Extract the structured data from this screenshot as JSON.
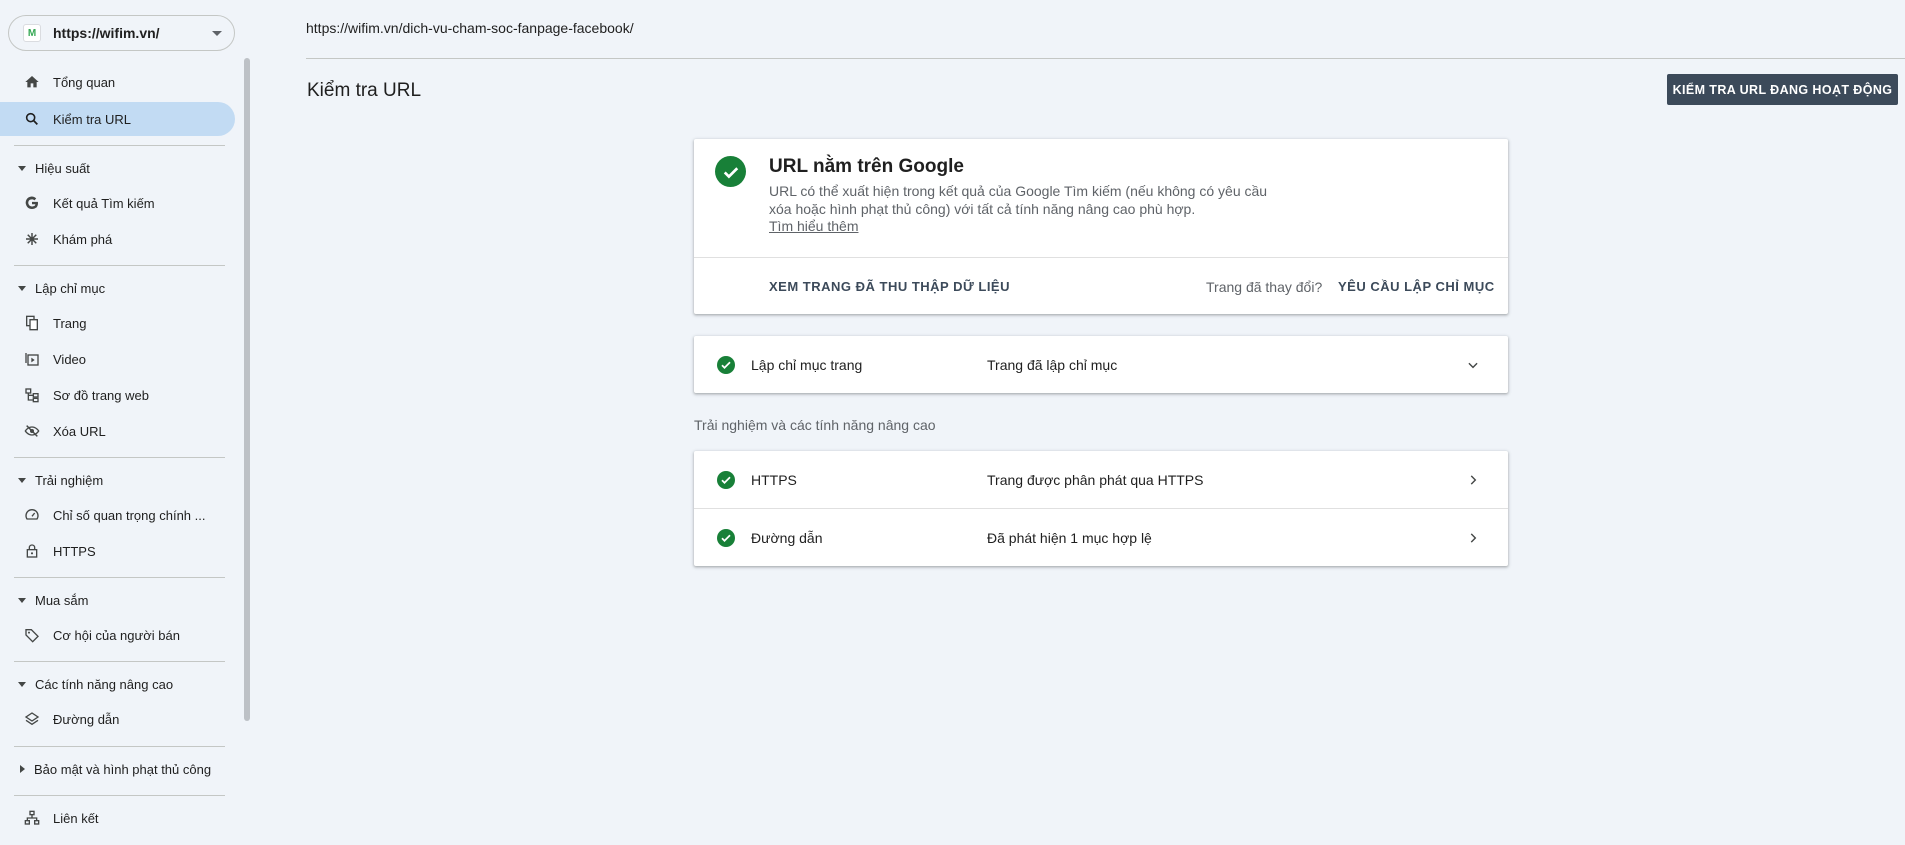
{
  "property": {
    "label": "https://wifim.vn/",
    "favicon_text": "M"
  },
  "sidebar": {
    "items": [
      {
        "label": "Tổng quan",
        "icon": "home-icon"
      },
      {
        "label": "Kiểm tra URL",
        "icon": "search-icon",
        "active": true
      }
    ],
    "sections": [
      {
        "label": "Hiệu suất",
        "items": [
          {
            "label": "Kết quả Tìm kiếm",
            "icon": "google-g-icon"
          },
          {
            "label": "Khám phá",
            "icon": "discover-asterisk-icon"
          }
        ]
      },
      {
        "label": "Lập chỉ mục",
        "items": [
          {
            "label": "Trang",
            "icon": "pages-icon"
          },
          {
            "label": "Video",
            "icon": "video-icon"
          },
          {
            "label": "Sơ đồ trang web",
            "icon": "sitemap-icon"
          },
          {
            "label": "Xóa URL",
            "icon": "eye-off-icon"
          }
        ]
      },
      {
        "label": "Trải nghiệm",
        "items": [
          {
            "label": "Chỉ số quan trọng chính ...",
            "icon": "speedometer-icon"
          },
          {
            "label": "HTTPS",
            "icon": "lock-icon"
          }
        ]
      },
      {
        "label": "Mua sắm",
        "items": [
          {
            "label": "Cơ hội của người bán",
            "icon": "tag-icon"
          }
        ]
      },
      {
        "label": "Các tính năng nâng cao",
        "items": [
          {
            "label": "Đường dẫn",
            "icon": "layers-icon"
          }
        ]
      },
      {
        "label": "Bảo mật và hình phạt thủ công",
        "collapsed": true
      },
      {
        "label": "Liên kết",
        "icon": "links-icon"
      }
    ]
  },
  "header": {
    "inspected_url": "https://wifim.vn/dich-vu-cham-soc-fanpage-facebook/",
    "page_title": "Kiểm tra URL",
    "live_test_button": "KIỂM TRA URL ĐANG HOẠT ĐỘNG"
  },
  "status": {
    "title": "URL nằm trên Google",
    "description": "URL có thể xuất hiện trong kết quả của Google Tìm kiếm (nếu không có yêu cầu xóa hoặc hình phạt thủ công) với tất cả tính năng nâng cao phù hợp.",
    "learn_more": "Tìm hiểu thêm",
    "view_crawled": "XEM TRANG ĐÃ THU THẬP DỮ LIỆU",
    "page_changed": "Trang đã thay đổi?",
    "request_indexing": "YÊU CẦU LẬP CHỈ MỤC"
  },
  "indexing": {
    "label": "Lập chỉ mục trang",
    "value": "Trang đã lập chỉ mục"
  },
  "enhancements": {
    "caption": "Trải nghiệm và các tính năng nâng cao",
    "rows": [
      {
        "label": "HTTPS",
        "value": "Trang được phân phát qua HTTPS"
      },
      {
        "label": "Đường dẫn",
        "value": "Đã phát hiện 1 mục hợp lệ"
      }
    ]
  },
  "colors": {
    "accent_green": "#188038",
    "active_nav": "#c2dbf3",
    "button_dark": "#3c4a5a",
    "background": "#f0f4f9"
  }
}
